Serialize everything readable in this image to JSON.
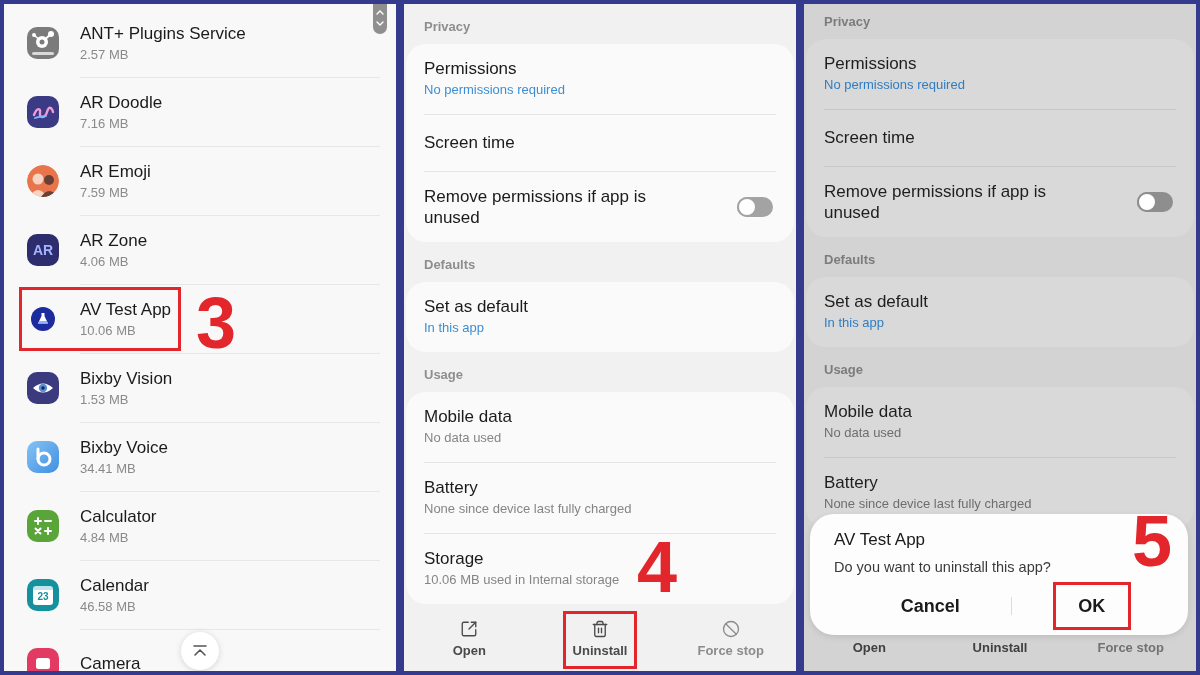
{
  "screens": [
    {
      "kind": "app_list",
      "apps": [
        {
          "name": "ANT+ Plugins Service",
          "size": "2.57 MB",
          "highlighted": false
        },
        {
          "name": "AR Doodle",
          "size": "7.16 MB",
          "highlighted": false
        },
        {
          "name": "AR Emoji",
          "size": "7.59 MB",
          "highlighted": false
        },
        {
          "name": "AR Zone",
          "size": "4.06 MB",
          "icon_label": "AR",
          "highlighted": false
        },
        {
          "name": "AV Test App",
          "size": "10.06 MB",
          "highlighted": true
        },
        {
          "name": "Bixby Vision",
          "size": "1.53 MB",
          "highlighted": false
        },
        {
          "name": "Bixby Voice",
          "size": "34.41 MB",
          "highlighted": false
        },
        {
          "name": "Calculator",
          "size": "4.84 MB",
          "highlighted": false
        },
        {
          "name": "Calendar",
          "size": "46.58 MB",
          "icon_label": "23",
          "highlighted": false
        },
        {
          "name": "Camera",
          "highlighted": false
        }
      ],
      "step_label": "3"
    },
    {
      "kind": "app_info",
      "dimmed": false,
      "sections": [
        {
          "header": "Privacy",
          "items": [
            {
              "kind": "nav",
              "title": "Permissions",
              "subtitle": "No permissions required",
              "accent": true
            },
            {
              "kind": "nav",
              "title": "Screen time"
            },
            {
              "kind": "switch",
              "title": "Remove permissions if app is unused",
              "on": false
            }
          ]
        },
        {
          "header": "Defaults",
          "items": [
            {
              "kind": "nav",
              "title": "Set as default",
              "subtitle": "In this app",
              "accent": true
            }
          ]
        },
        {
          "header": "Usage",
          "items": [
            {
              "kind": "nav",
              "title": "Mobile data",
              "subtitle": "No data used",
              "accent": false
            },
            {
              "kind": "nav",
              "title": "Battery",
              "subtitle": "None since device last fully charged",
              "accent": false
            },
            {
              "kind": "nav",
              "title": "Storage",
              "subtitle": "10.06 MB used in Internal storage",
              "accent": false
            }
          ]
        }
      ],
      "actions": [
        {
          "label": "Open",
          "disabled": false,
          "highlighted": false
        },
        {
          "label": "Uninstall",
          "disabled": false,
          "highlighted": true
        },
        {
          "label": "Force stop",
          "disabled": true,
          "highlighted": false
        }
      ],
      "step_label": "4"
    },
    {
      "kind": "app_info",
      "dimmed": true,
      "sections": [
        {
          "header": "Privacy",
          "items": [
            {
              "kind": "nav",
              "title": "Permissions",
              "subtitle": "No permissions required",
              "accent": true
            },
            {
              "kind": "nav",
              "title": "Screen time"
            },
            {
              "kind": "switch",
              "title": "Remove permissions if app is unused",
              "on": false
            }
          ]
        },
        {
          "header": "Defaults",
          "items": [
            {
              "kind": "nav",
              "title": "Set as default",
              "subtitle": "In this app",
              "accent": true
            }
          ]
        },
        {
          "header": "Usage",
          "items": [
            {
              "kind": "nav",
              "title": "Mobile data",
              "subtitle": "No data used",
              "accent": false
            },
            {
              "kind": "nav",
              "title": "Battery",
              "subtitle": "None since device last fully charged",
              "accent": false
            }
          ]
        }
      ],
      "actions": [
        {
          "label": "Open",
          "disabled": false,
          "highlighted": false
        },
        {
          "label": "Uninstall",
          "disabled": false,
          "highlighted": false
        },
        {
          "label": "Force stop",
          "disabled": true,
          "highlighted": false
        }
      ],
      "dialog": {
        "title": "AV Test App",
        "message": "Do you want to uninstall this app?",
        "buttons": [
          {
            "label": "Cancel",
            "highlighted": false
          },
          {
            "label": "OK",
            "highlighted": true
          }
        ],
        "step_label": "5"
      }
    }
  ]
}
